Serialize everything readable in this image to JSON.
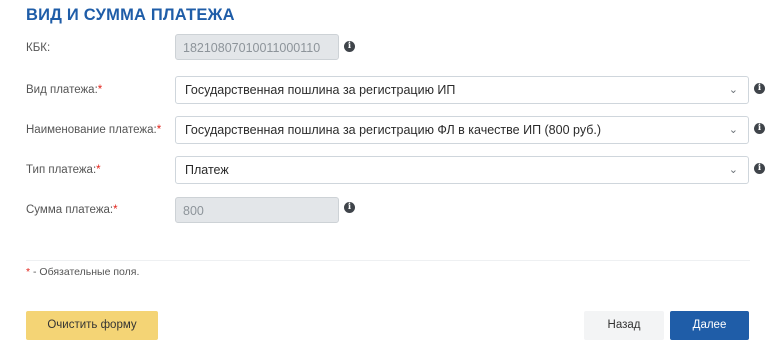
{
  "section": {
    "title": "ВИД И СУММА ПЛАТЕЖА"
  },
  "fields": {
    "kbk": {
      "label": "КБК:",
      "value": "18210807010011000110"
    },
    "payment_type": {
      "label": "Вид платежа:",
      "required_mark": "*",
      "value": "Государственная пошлина за регистрацию ИП"
    },
    "payment_name": {
      "label": "Наименование платежа:",
      "required_mark": "*",
      "value": "Государственная пошлина за регистрацию ФЛ в качестве ИП (800 руб.)"
    },
    "payment_kind": {
      "label": "Тип платежа:",
      "required_mark": "*",
      "value": "Платеж"
    },
    "amount": {
      "label": "Сумма платежа:",
      "required_mark": "*",
      "value": "800"
    }
  },
  "note": {
    "mark": "*",
    "text": " - Обязательные поля."
  },
  "buttons": {
    "clear": "Очистить форму",
    "back": "Назад",
    "next": "Далее"
  },
  "icons": {
    "info": "i",
    "chevron": "⌄"
  },
  "colors": {
    "accent": "#1f5da8",
    "required": "#e2231a",
    "clear_button": "#f4d475"
  }
}
